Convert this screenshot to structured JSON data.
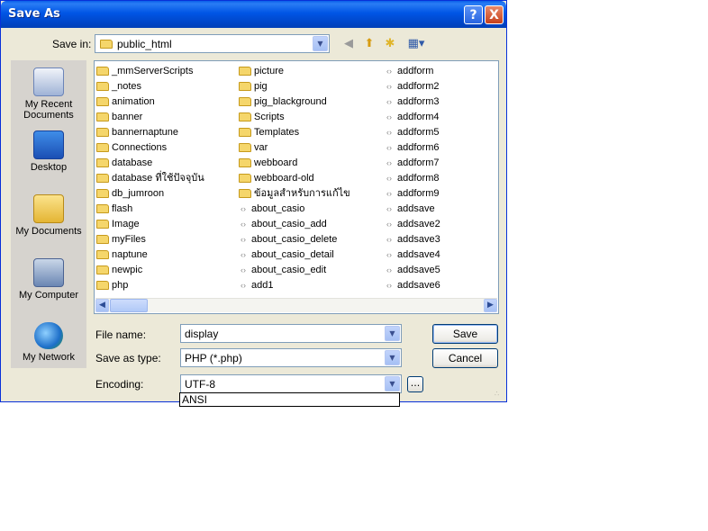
{
  "window": {
    "title": "Save As"
  },
  "save_in": {
    "label": "Save in:",
    "value": "public_html"
  },
  "toolbar": {
    "back_icon": "back-icon",
    "up_icon": "up-folder-icon",
    "new_folder_icon": "new-folder-icon",
    "views_icon": "views-menu-icon"
  },
  "places": [
    {
      "label": "My Recent Documents",
      "icon": "recent-documents-icon"
    },
    {
      "label": "Desktop",
      "icon": "desktop-icon"
    },
    {
      "label": "My Documents",
      "icon": "my-documents-icon"
    },
    {
      "label": "My Computer",
      "icon": "my-computer-icon"
    },
    {
      "label": "My Network",
      "icon": "my-network-icon"
    }
  ],
  "files": {
    "col1": [
      {
        "name": "_mmServerScripts",
        "type": "folder"
      },
      {
        "name": "_notes",
        "type": "folder"
      },
      {
        "name": "animation",
        "type": "folder"
      },
      {
        "name": "banner",
        "type": "folder"
      },
      {
        "name": "bannernaptune",
        "type": "folder"
      },
      {
        "name": "Connections",
        "type": "folder"
      },
      {
        "name": "database",
        "type": "folder"
      },
      {
        "name": "database ที่ใช้ปัจจุบัน",
        "type": "folder"
      },
      {
        "name": "db_jumroon",
        "type": "folder"
      },
      {
        "name": "flash",
        "type": "folder"
      },
      {
        "name": "Image",
        "type": "folder"
      },
      {
        "name": "myFiles",
        "type": "folder"
      },
      {
        "name": "naptune",
        "type": "folder"
      },
      {
        "name": "newpic",
        "type": "folder"
      },
      {
        "name": "php",
        "type": "folder"
      }
    ],
    "col2": [
      {
        "name": "picture",
        "type": "folder"
      },
      {
        "name": "pig",
        "type": "folder"
      },
      {
        "name": "pig_blackground",
        "type": "folder"
      },
      {
        "name": "Scripts",
        "type": "folder"
      },
      {
        "name": "Templates",
        "type": "folder"
      },
      {
        "name": "var",
        "type": "folder"
      },
      {
        "name": "webboard",
        "type": "folder"
      },
      {
        "name": "webboard-old",
        "type": "folder"
      },
      {
        "name": "ข้อมูลสำหรับการแก้ไข",
        "type": "folder"
      },
      {
        "name": "about_casio",
        "type": "php"
      },
      {
        "name": "about_casio_add",
        "type": "php"
      },
      {
        "name": "about_casio_delete",
        "type": "php"
      },
      {
        "name": "about_casio_detail",
        "type": "php"
      },
      {
        "name": "about_casio_edit",
        "type": "php"
      },
      {
        "name": "add1",
        "type": "php"
      }
    ],
    "col3": [
      {
        "name": "addform",
        "type": "php"
      },
      {
        "name": "addform2",
        "type": "php"
      },
      {
        "name": "addform3",
        "type": "php"
      },
      {
        "name": "addform4",
        "type": "php"
      },
      {
        "name": "addform5",
        "type": "php"
      },
      {
        "name": "addform6",
        "type": "php"
      },
      {
        "name": "addform7",
        "type": "php"
      },
      {
        "name": "addform8",
        "type": "php"
      },
      {
        "name": "addform9",
        "type": "php"
      },
      {
        "name": "addsave",
        "type": "php"
      },
      {
        "name": "addsave2",
        "type": "php"
      },
      {
        "name": "addsave3",
        "type": "php"
      },
      {
        "name": "addsave4",
        "type": "php"
      },
      {
        "name": "addsave5",
        "type": "php"
      },
      {
        "name": "addsave6",
        "type": "php"
      }
    ]
  },
  "file_name": {
    "label": "File name:",
    "value": "display"
  },
  "save_type": {
    "label": "Save as type:",
    "value": "PHP (*.php)"
  },
  "encoding": {
    "label": "Encoding:",
    "value": "UTF-8",
    "more": "...",
    "dropdown_option": "ANSI"
  },
  "buttons": {
    "save": "Save",
    "cancel": "Cancel",
    "help": "?",
    "close": "X"
  }
}
